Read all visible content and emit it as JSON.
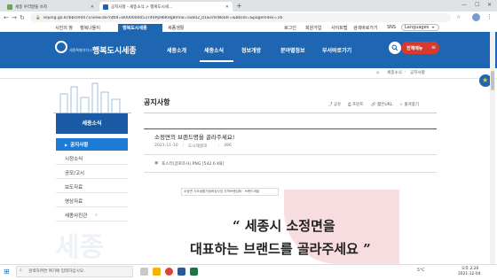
{
  "browser": {
    "tabs": [
      {
        "label": "세종 우리말을 쓰자"
      },
      {
        "label": "공지사항 - 세종소식 > 행복도시세..."
      }
    ],
    "new_tab_label": "+",
    "url": "sejong.go.kr/bbs/R0071/view.do?nttId=B000000053746Pp9bK9g8mno=sub02_01&cmsNoStr=&bbsId=&pageIndex=16"
  },
  "utility": {
    "left_links": [
      "시민의 창",
      "행복나들이",
      "행복도시세종",
      "세종생활"
    ],
    "right_links": [
      "로그인",
      "회원가입",
      "사이트맵",
      "검색바로가기"
    ],
    "sns": "SNS",
    "languages": "Languages"
  },
  "header": {
    "logo_text": "행복도시세종",
    "logo_sub": "세종특별자치시",
    "menu": [
      "세종소개",
      "세종소식",
      "정보개방",
      "분야별정보",
      "부서바로가기"
    ],
    "menu_all_button": "전체메뉴",
    "search_icon": "search-icon"
  },
  "breadcrumb": [
    "세종소식",
    "공지사항"
  ],
  "sidebar": {
    "title": "세종소식",
    "items": [
      {
        "label": "공지사항",
        "active": true
      },
      {
        "label": "시정소식",
        "active": false
      },
      {
        "label": "공모/고시",
        "active": false
      },
      {
        "label": "보도자료",
        "active": false
      },
      {
        "label": "영상자료",
        "active": false
      },
      {
        "label": "세종사진관",
        "active": false
      }
    ],
    "background_text": "세종"
  },
  "page": {
    "title": "공지사항",
    "tools": [
      "공유",
      "프린트",
      "짧은URL",
      "즐겨찾기"
    ]
  },
  "article": {
    "title": "소정면의 브랜드명을 골라주세요!",
    "date": "2021-11-10",
    "dept": "도시재생과",
    "views": "396",
    "attachment": "포스터(글로조사).PNG [542.6 KB]",
    "poster_caption": "소정면 기초생활거점육성사업 지역브랜딩화 · 브랜드개발",
    "poster_line1": "“ 세종시 소정면을",
    "poster_line2": "대표하는 브랜드를 골라주세요 ”"
  },
  "taskbar": {
    "search_placeholder": "검색하려면 여기에 입력하십시오.",
    "temp": "5°C",
    "time": "오후 2:20",
    "date": "2021-12-04"
  },
  "colors": {
    "header_blue": "#1f66b2",
    "sidebar_blue": "#1d7cd6",
    "all_menu_red": "#d63a2f",
    "poster_pink": "#f7dde0"
  }
}
